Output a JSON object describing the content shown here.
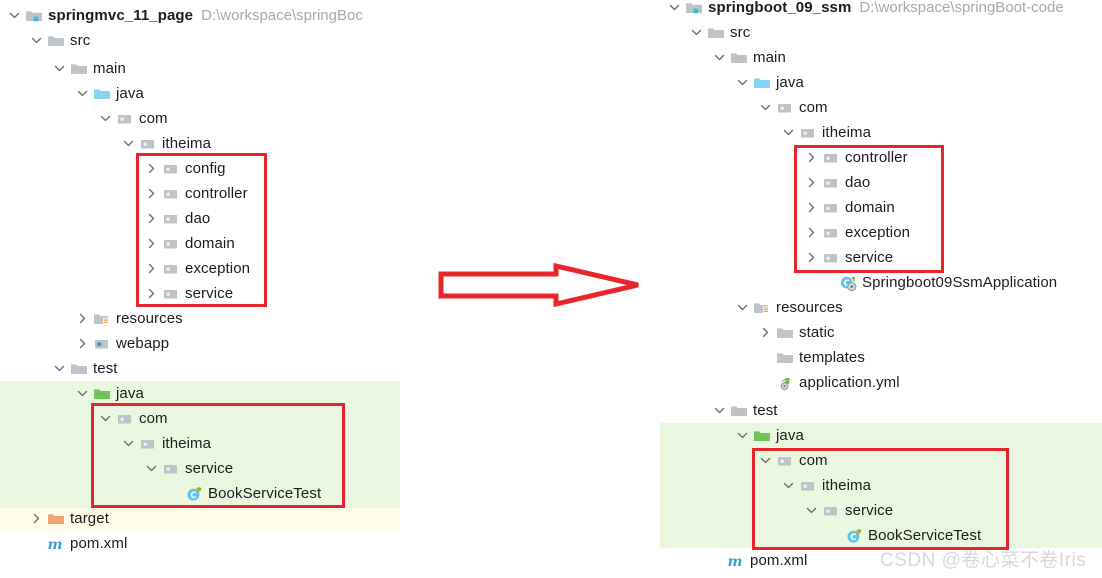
{
  "left_project": {
    "name": "springmvc_11_page",
    "path": "D:\\workspace\\springBoc",
    "rows": [
      {
        "label": "springmvc_11_page",
        "icon": "project-folder-icon",
        "indent": 0,
        "twisty": "expanded",
        "bold": true,
        "path": "D:\\workspace\\springBoc"
      },
      {
        "label": "src",
        "icon": "folder-icon",
        "indent": 1,
        "twisty": "expanded"
      },
      {
        "label": "main",
        "icon": "folder-icon",
        "indent": 2,
        "twisty": "expanded"
      },
      {
        "label": "java",
        "icon": "sources-folder-icon",
        "indent": 3,
        "twisty": "expanded"
      },
      {
        "label": "com",
        "icon": "package-icon",
        "indent": 4,
        "twisty": "expanded"
      },
      {
        "label": "itheima",
        "icon": "package-icon",
        "indent": 5,
        "twisty": "expanded"
      },
      {
        "label": "config",
        "icon": "package-icon",
        "indent": 6,
        "twisty": "collapsed"
      },
      {
        "label": "controller",
        "icon": "package-icon",
        "indent": 6,
        "twisty": "collapsed"
      },
      {
        "label": "dao",
        "icon": "package-icon",
        "indent": 6,
        "twisty": "collapsed"
      },
      {
        "label": "domain",
        "icon": "package-icon",
        "indent": 6,
        "twisty": "collapsed"
      },
      {
        "label": "exception",
        "icon": "package-icon",
        "indent": 6,
        "twisty": "collapsed"
      },
      {
        "label": "service",
        "icon": "package-icon",
        "indent": 6,
        "twisty": "collapsed"
      },
      {
        "label": "resources",
        "icon": "resources-folder-icon",
        "indent": 3,
        "twisty": "collapsed"
      },
      {
        "label": "webapp",
        "icon": "webapp-folder-icon",
        "indent": 3,
        "twisty": "collapsed"
      },
      {
        "label": "test",
        "icon": "folder-icon",
        "indent": 2,
        "twisty": "expanded"
      },
      {
        "label": "java",
        "icon": "test-sources-folder-icon",
        "indent": 3,
        "twisty": "expanded"
      },
      {
        "label": "com",
        "icon": "package-icon",
        "indent": 4,
        "twisty": "expanded"
      },
      {
        "label": "itheima",
        "icon": "package-icon",
        "indent": 5,
        "twisty": "expanded"
      },
      {
        "label": "service",
        "icon": "package-icon",
        "indent": 6,
        "twisty": "expanded"
      },
      {
        "label": "BookServiceTest",
        "icon": "test-class-icon",
        "indent": 7,
        "twisty": "none"
      },
      {
        "label": "target",
        "icon": "target-folder-icon",
        "indent": 1,
        "twisty": "collapsed"
      },
      {
        "label": "pom.xml",
        "icon": "maven-icon",
        "indent": 1,
        "twisty": "none"
      }
    ]
  },
  "right_project": {
    "name": "springboot_09_ssm",
    "path": "D:\\workspace\\springBoot-code",
    "rows": [
      {
        "label": "springboot_09_ssm",
        "icon": "project-folder-icon",
        "indent": 0,
        "twisty": "expanded",
        "bold": true,
        "path": "D:\\workspace\\springBoot-code"
      },
      {
        "label": "src",
        "icon": "folder-icon",
        "indent": 1,
        "twisty": "expanded"
      },
      {
        "label": "main",
        "icon": "folder-icon",
        "indent": 2,
        "twisty": "expanded"
      },
      {
        "label": "java",
        "icon": "sources-folder-icon",
        "indent": 3,
        "twisty": "expanded"
      },
      {
        "label": "com",
        "icon": "package-icon",
        "indent": 4,
        "twisty": "expanded"
      },
      {
        "label": "itheima",
        "icon": "package-icon",
        "indent": 5,
        "twisty": "expanded"
      },
      {
        "label": "controller",
        "icon": "package-icon",
        "indent": 6,
        "twisty": "collapsed"
      },
      {
        "label": "dao",
        "icon": "package-icon",
        "indent": 6,
        "twisty": "collapsed"
      },
      {
        "label": "domain",
        "icon": "package-icon",
        "indent": 6,
        "twisty": "collapsed"
      },
      {
        "label": "exception",
        "icon": "package-icon",
        "indent": 6,
        "twisty": "collapsed"
      },
      {
        "label": "service",
        "icon": "package-icon",
        "indent": 6,
        "twisty": "collapsed"
      },
      {
        "label": "Springboot09SsmApplication",
        "icon": "spring-class-icon",
        "indent": 6,
        "twisty": "none"
      },
      {
        "label": "resources",
        "icon": "resources-folder-icon",
        "indent": 3,
        "twisty": "expanded"
      },
      {
        "label": "static",
        "icon": "folder-icon",
        "indent": 4,
        "twisty": "collapsed"
      },
      {
        "label": "templates",
        "icon": "folder-icon",
        "indent": 4,
        "twisty": "none"
      },
      {
        "label": "application.yml",
        "icon": "yml-icon",
        "indent": 4,
        "twisty": "none"
      },
      {
        "label": "test",
        "icon": "folder-icon",
        "indent": 2,
        "twisty": "expanded"
      },
      {
        "label": "java",
        "icon": "test-sources-folder-icon",
        "indent": 3,
        "twisty": "expanded"
      },
      {
        "label": "com",
        "icon": "package-icon",
        "indent": 4,
        "twisty": "expanded"
      },
      {
        "label": "itheima",
        "icon": "package-icon",
        "indent": 5,
        "twisty": "expanded"
      },
      {
        "label": "service",
        "icon": "package-icon",
        "indent": 6,
        "twisty": "expanded"
      },
      {
        "label": "BookServiceTest",
        "icon": "test-class-icon",
        "indent": 7,
        "twisty": "none"
      },
      {
        "label": "pom.xml",
        "icon": "maven-icon",
        "indent": 1,
        "twisty": "none"
      }
    ]
  },
  "annotations": {
    "arrow": {
      "direction": "right",
      "color": "#e8252a"
    },
    "box_color": "#e8252a",
    "highlight_green": "#eaf7e1",
    "highlight_yellow": "#fdfce9"
  },
  "watermark": "CSDN @卷心菜不卷Iris"
}
